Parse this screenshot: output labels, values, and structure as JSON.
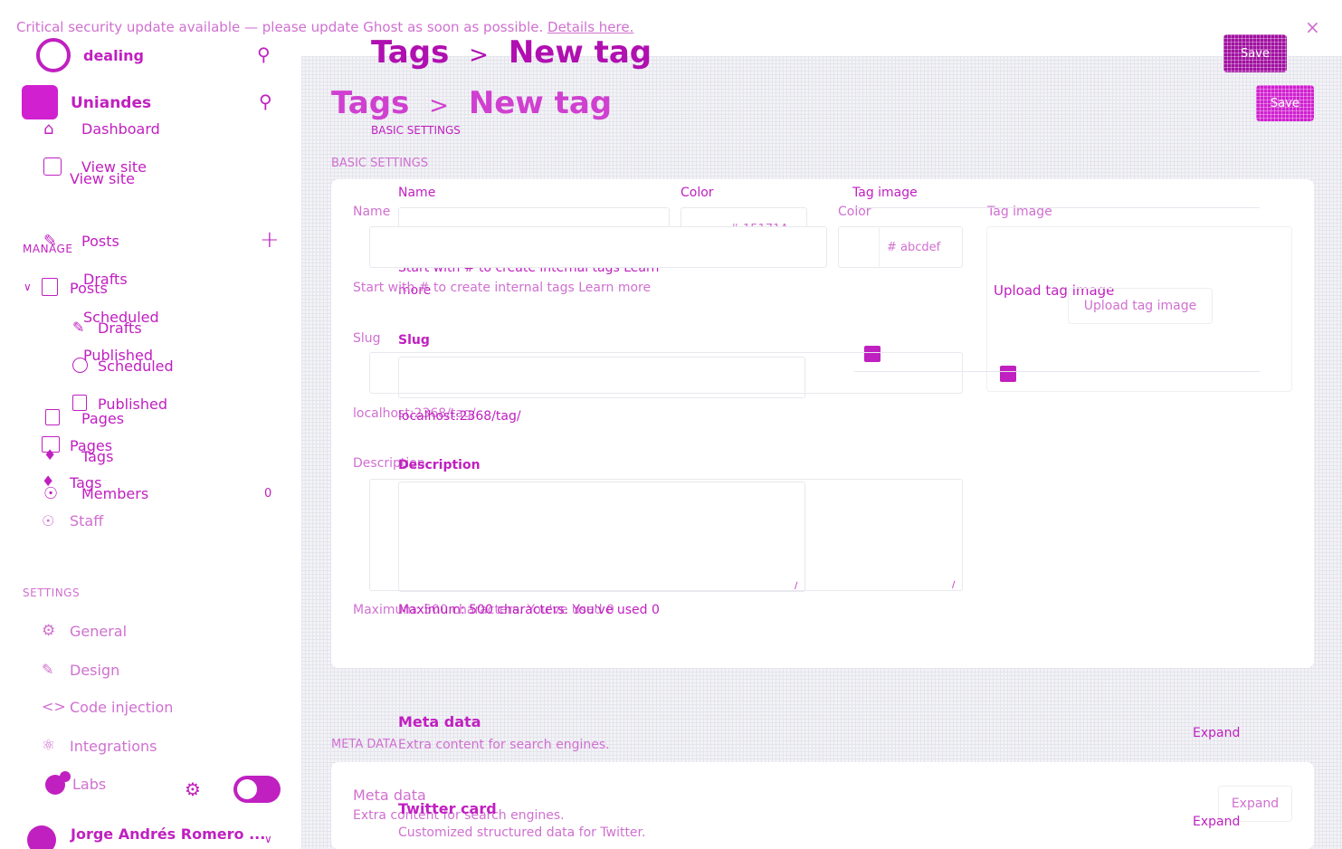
{
  "banner": {
    "text": "Critical security update available — please update Ghost as soon as possible.",
    "link": "Details here.",
    "close": "×"
  },
  "sidebar": {
    "site_top": "dealing",
    "site_name": "Uniandes",
    "items_top": [
      "Dashboard",
      "View site"
    ],
    "view_site_2": "View site",
    "manage_header": "MANAGE",
    "posts": "Posts",
    "posts_2": "Posts",
    "drafts": "Drafts",
    "drafts_2": "Drafts",
    "scheduled": "Scheduled",
    "scheduled_2": "Scheduled",
    "published": "Published",
    "published_2": "Published",
    "pages": "Pages",
    "pages_2": "Pages",
    "tags": "Tags",
    "tags_2": "Tags",
    "members": "Members",
    "members_count": "0",
    "staff": "Staff",
    "settings_header": "SETTINGS",
    "general": "General",
    "design": "Design",
    "code_injection": "Code injection",
    "integrations": "Integrations",
    "labs": "Labs",
    "user_name": "Jorge Andrés Romero ..."
  },
  "header": {
    "crumb_parent": "Tags",
    "crumb_sep": ">",
    "crumb_current": "New tag",
    "save_label": "Save"
  },
  "form": {
    "basic_settings": "BASIC SETTINGS",
    "name_label": "Name",
    "color_label": "Color",
    "tag_image_label": "Tag image",
    "color_value_1": "# 15171A",
    "color_value_2": "# abcdef",
    "name_hint": "Start with # to create internal tags Learn more",
    "name_hint_a": "Start with # to create internal tags Learn",
    "name_hint_b": "more",
    "upload_label": "Upload tag image",
    "slug_label": "Slug",
    "slug_hint": "localhost:2368/tag/",
    "description_label": "Description",
    "desc_hint": "Maximum: 500 characters. You've used",
    "desc_count": "0"
  },
  "meta": {
    "header": "META DATA",
    "title": "Meta data",
    "subtitle": "Extra content for search engines.",
    "expand": "Expand",
    "twitter_title": "Twitter card",
    "twitter_subtitle": "Customized structured data for Twitter."
  },
  "colors": {
    "accent": "#c020c0",
    "background": "#f3f3f7"
  }
}
